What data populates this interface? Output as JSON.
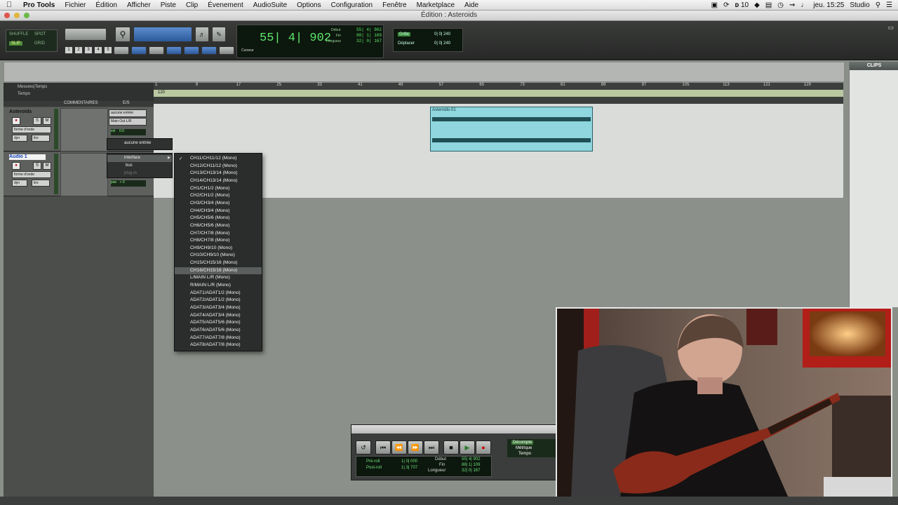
{
  "menubar": {
    "app": "Pro Tools",
    "items": [
      "Fichier",
      "Édition",
      "Afficher",
      "Piste",
      "Clip",
      "Évenement",
      "AudioSuite",
      "Options",
      "Configuration",
      "Fenêtre",
      "Marketplace",
      "Aide"
    ],
    "status_number": "10",
    "clock": "jeu. 15:25",
    "user": "Studio"
  },
  "window": {
    "title": "Édition : Asteroids"
  },
  "toolbar": {
    "modes": [
      "SHUFFLE",
      "SPOT",
      "SLIP",
      "GRID"
    ],
    "zoom_presets": [
      "1",
      "2",
      "3",
      "4",
      "5"
    ],
    "counter_main": "55| 4| 902",
    "counter_labels": [
      "Début",
      "Fin",
      "Longueur"
    ],
    "counter_values": [
      "55| 4| 902",
      "88| 1| 109",
      "32| 0| 167"
    ],
    "counter_mode_label": "Curseur",
    "grid_label": "Grille",
    "grid_value": "0| 0| 240",
    "nudge_label": "Déplacer",
    "nudge_value": "0| 0| 240"
  },
  "clips_panel": {
    "title": "CLIPS"
  },
  "ruler": {
    "rows": [
      "Mesures|Temps",
      "Tempo"
    ],
    "bars": [
      "1",
      "9",
      "17",
      "25",
      "33",
      "41",
      "49",
      "57",
      "65",
      "73",
      "81",
      "89",
      "97",
      "105",
      "113",
      "121",
      "129"
    ],
    "tempo_value": "120"
  },
  "track_header": {
    "comments": "COMMENTAIRES",
    "io": "E/S"
  },
  "tracks": [
    {
      "name": "Asteroids",
      "input": "aucune entrée",
      "output": "Main Out L/R",
      "view": "forme d'onde",
      "dyn": "dyn",
      "dyn_value": "lire",
      "vol_label": "vol",
      "vol_value": "0.0"
    },
    {
      "name": "Audio 1",
      "view": "forme d'onde",
      "dyn": "dyn",
      "dyn_value": "lire",
      "pan_label": "pan",
      "pan_value": "> 0"
    }
  ],
  "clip": {
    "name": "Asteroids-01"
  },
  "io_popup": {
    "none_input": "aucune entrée",
    "categories": [
      "interface",
      "bus",
      "plug-in"
    ]
  },
  "submenu": {
    "checked_index": 0,
    "highlighted_index": 15,
    "items": [
      "CH11/CH11/12 (Mono)",
      "CH12/CH11/12 (Mono)",
      "CH13/CH13/14 (Mono)",
      "CH14/CH13/14 (Mono)",
      "CH1/CH1/2 (Mono)",
      "CH2/CH1/2 (Mono)",
      "CH3/CH3/4 (Mono)",
      "CH4/CH3/4 (Mono)",
      "CH5/CH5/6 (Mono)",
      "CH6/CH5/6 (Mono)",
      "CH7/CH7/8 (Mono)",
      "CH8/CH7/8 (Mono)",
      "CH9/CH9/10 (Mono)",
      "CH10/CH9/10 (Mono)",
      "CH15/CH15/16 (Mono)",
      "CH16/CH15/16 (Mono)",
      "L/MAIN L/R (Mono)",
      "R/MAIN L/R (Mono)",
      "ADAT1/ADAT1/2 (Mono)",
      "ADAT2/ADAT1/2 (Mono)",
      "ADAT3/ADAT3/4 (Mono)",
      "ADAT4/ADAT3/4 (Mono)",
      "ADAT5/ADAT5/6 (Mono)",
      "ADAT6/ADAT5/6 (Mono)",
      "ADAT7/ADAT7/8 (Mono)",
      "ADAT8/ADAT7/8 (Mono)"
    ]
  },
  "transport": {
    "preroll": "Pré-roll",
    "postroll": "Post-roll",
    "preroll_value": "1| 0| 000",
    "postroll_value": "1| 3| 707",
    "labels": [
      "Début",
      "Fin",
      "Longueur"
    ],
    "values": [
      "55| 4| 902",
      "88| 1| 109",
      "32| 0| 167"
    ],
    "countoff": "Décompte",
    "metronome": "Métrique",
    "tempo": "Tempo"
  }
}
